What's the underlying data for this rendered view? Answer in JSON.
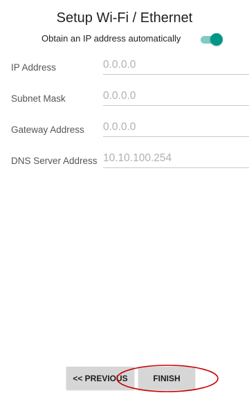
{
  "header": {
    "title": "Setup Wi-Fi / Ethernet"
  },
  "dhcp": {
    "label": "Obtain an IP address automatically",
    "enabled": true,
    "toggle_colors": {
      "thumb": "#009688",
      "track": "#80cbc4"
    }
  },
  "fields": [
    {
      "label": "IP Address",
      "placeholder": "0.0.0.0"
    },
    {
      "label": "Subnet Mask",
      "placeholder": "0.0.0.0"
    },
    {
      "label": "Gateway Address",
      "placeholder": "0.0.0.0"
    },
    {
      "label": "DNS Server Address",
      "placeholder": "10.10.100.254"
    }
  ],
  "footer": {
    "previous_label": "<< PREVIOUS",
    "finish_label": "FINISH",
    "highlight_color": "#cc0000"
  }
}
